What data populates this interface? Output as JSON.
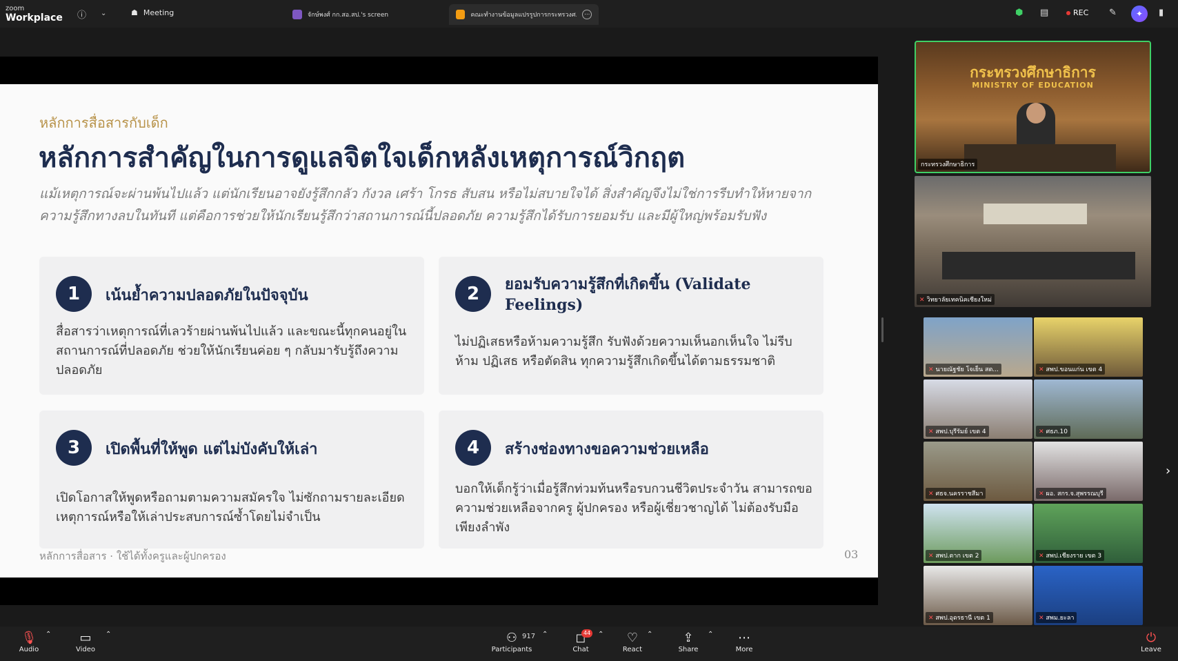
{
  "topbar": {
    "brand_small": "zoom",
    "brand_big": "Workplace",
    "meeting_label": "Meeting",
    "tab1_label": "จักษ์พงศ์ กก.สอ.สป.'s screen",
    "tab2_label": "คณะทำงานข้อมูลแปรรูปการกระทรวงศ...'s",
    "rec_label": "REC"
  },
  "slide": {
    "eyebrow": "หลักการสื่อสารกับเด็ก",
    "title": "หลักการสำคัญในการดูแลจิตใจเด็กหลังเหตุการณ์วิกฤต",
    "lead": "แม้เหตุการณ์จะผ่านพ้นไปแล้ว แต่นักเรียนอาจยังรู้สึกกลัว กังวล เศร้า โกรธ สับสน หรือไม่สบายใจได้ สิ่งสำคัญจึงไม่ใช่การรีบทำให้หายจากความรู้สึกทางลบในทันที แต่คือการช่วยให้นักเรียนรู้สึกว่าสถานการณ์นี้ปลอดภัย ความรู้สึกได้รับการยอมรับ และมีผู้ใหญ่พร้อมรับฟัง",
    "cards": [
      {
        "num": "1",
        "title": "เน้นย้ำความปลอดภัยในปัจจุบัน",
        "body": "สื่อสารว่าเหตุการณ์ที่เลวร้ายผ่านพ้นไปแล้ว และขณะนี้ทุกคนอยู่ในสถานการณ์ที่ปลอดภัย ช่วยให้นักเรียนค่อย ๆ กลับมารับรู้ถึงความปลอดภัย"
      },
      {
        "num": "2",
        "title": "ยอมรับความรู้สึกที่เกิดขึ้น (Validate Feelings)",
        "body": "ไม่ปฏิเสธหรือห้ามความรู้สึก รับฟังด้วยความเห็นอกเห็นใจ ไม่รีบห้าม ปฏิเสธ หรือตัดสิน ทุกความรู้สึกเกิดขึ้นได้ตามธรรมชาติ"
      },
      {
        "num": "3",
        "title": "เปิดพื้นที่ให้พูด แต่ไม่บังคับให้เล่า",
        "body": "เปิดโอกาสให้พูดหรือถามตามความสมัครใจ ไม่ซักถามรายละเอียดเหตุการณ์หรือให้เล่าประสบการณ์ซ้ำโดยไม่จำเป็น"
      },
      {
        "num": "4",
        "title": "สร้างช่องทางขอความช่วยเหลือ",
        "body": "บอกให้เด็กรู้ว่าเมื่อรู้สึกท่วมท้นหรือรบกวนชีวิตประจำวัน สามารถขอความช่วยเหลือจากครู ผู้ปกครอง หรือผู้เชี่ยวชาญได้ ไม่ต้องรับมือเพียงลำพัง"
      }
    ],
    "footer_left": "หลักการสื่อสาร · ใช้ได้ทั้งครูและผู้ปกครอง",
    "footer_right": "03"
  },
  "videos": {
    "speaker": {
      "label": "กระทรวงศึกษาธิการ",
      "banner_th": "กระทรวงศึกษาธิการ",
      "banner_en": "MINISTRY OF EDUCATION"
    },
    "room": {
      "label": "วิทยาลัยเทคนิคเชียงใหม่"
    },
    "grid": [
      {
        "label": "นายณัฐชัย โจเย็น สต..."
      },
      {
        "label": "สพป.ขอนแก่น เขต 4"
      },
      {
        "label": "สพป.บุรีรัมย์ เขต 4"
      },
      {
        "label": "ศธภ.10"
      },
      {
        "label": "ศธจ.นครราชสีมา"
      },
      {
        "label": "ผอ. สกร.จ.สุพรรณบุรี"
      },
      {
        "label": "สพป.ตาก เขต 2"
      },
      {
        "label": "สพป.เชียงราย เขต 3"
      },
      {
        "label": "สพป.อุดรธานี เขต 1"
      },
      {
        "label": "สพม.ยะลา"
      }
    ]
  },
  "toolbar": {
    "audio": "Audio",
    "video": "Video",
    "participants": "Participants",
    "participants_count": "917",
    "chat": "Chat",
    "chat_badge": "44",
    "react": "React",
    "share": "Share",
    "more": "More",
    "leave": "Leave"
  },
  "colors": {
    "accent_navy": "#1e2d4f",
    "eyebrow_gold": "#b8934a",
    "speaker_border": "#3fd066",
    "rec_red": "#e53935"
  }
}
